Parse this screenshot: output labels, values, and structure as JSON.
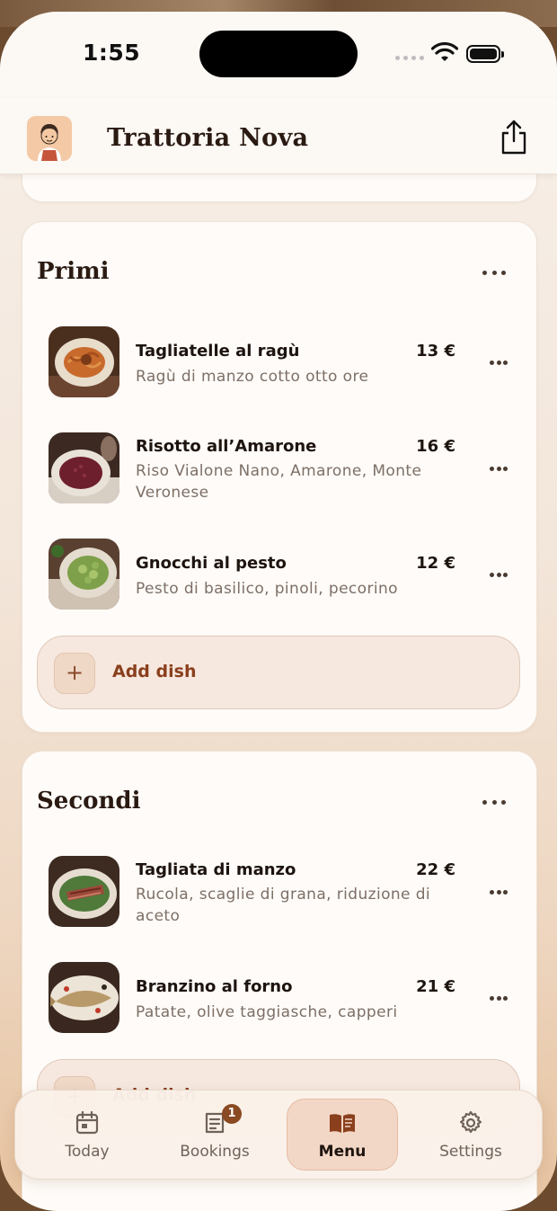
{
  "status_bar": {
    "time": "1:55"
  },
  "header": {
    "title": "Trattoria Nova",
    "share_icon": "share-icon",
    "avatar_icon": "chef-avatar-icon"
  },
  "sections": [
    {
      "title": "Primi",
      "dishes": [
        {
          "name": "Tagliatelle al ragù",
          "price": "13 €",
          "description": "Ragù di manzo cotto otto ore"
        },
        {
          "name": "Risotto all’Amarone",
          "price": "16 €",
          "description": "Riso Vialone Nano, Amarone, Monte Veronese"
        },
        {
          "name": "Gnocchi al pesto",
          "price": "12 €",
          "description": "Pesto di basilico, pinoli, pecorino"
        }
      ],
      "add_label": "Add dish"
    },
    {
      "title": "Secondi",
      "dishes": [
        {
          "name": "Tagliata di manzo",
          "price": "22 €",
          "description": "Rucola, scaglie di grana, riduzione di aceto"
        },
        {
          "name": "Branzino al forno",
          "price": "21 €",
          "description": "Patate, olive taggiasche, capperi"
        }
      ],
      "add_label": "Add dish"
    }
  ],
  "tabbar": {
    "tabs": [
      {
        "label": "Today",
        "icon": "calendar-icon"
      },
      {
        "label": "Bookings",
        "icon": "bookings-icon",
        "badge": "1"
      },
      {
        "label": "Menu",
        "icon": "menu-book-icon",
        "active": true
      },
      {
        "label": "Settings",
        "icon": "gear-icon"
      }
    ]
  },
  "colors": {
    "accent": "#8a3f1d",
    "badge": "#8a4a22",
    "active_tab_bg": "#f3d7c6"
  }
}
